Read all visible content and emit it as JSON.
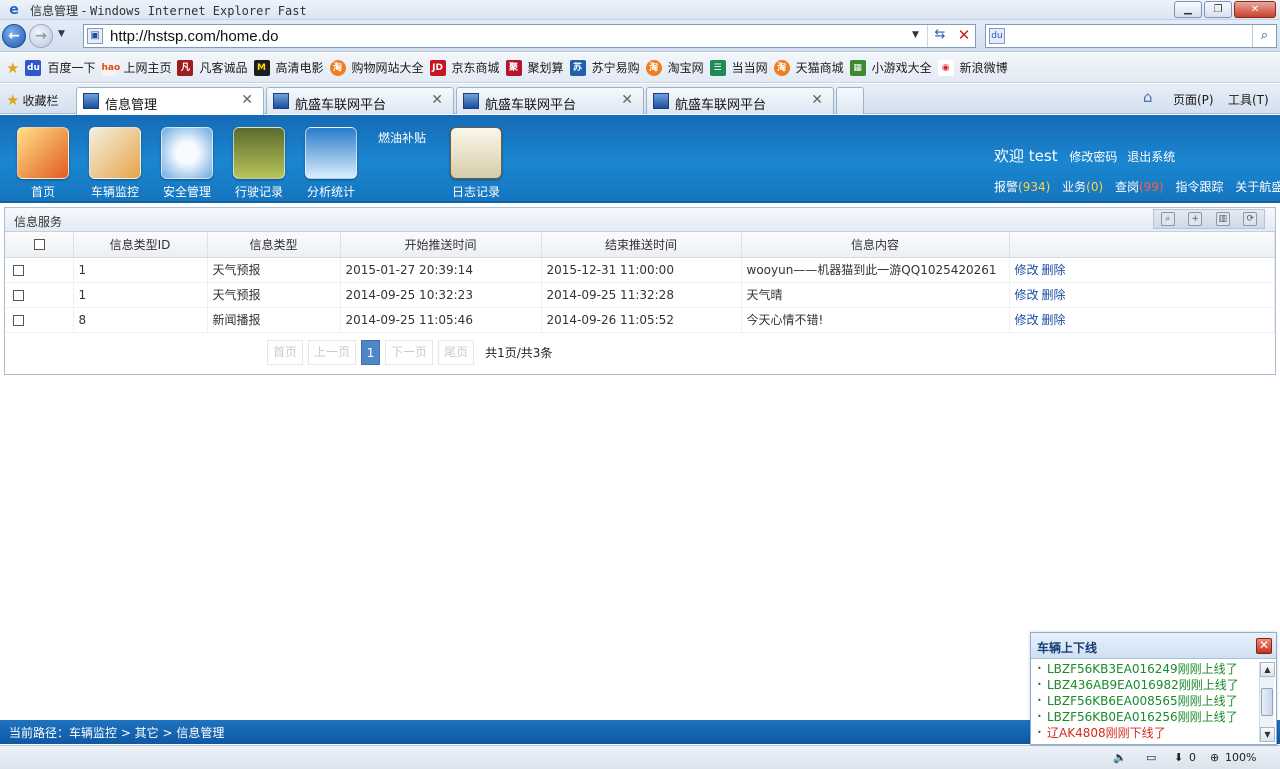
{
  "window": {
    "title_prefix": "信息管理 - ",
    "title_suffix": "Windows Internet Explorer Fast"
  },
  "address": {
    "url": "http://hstsp.com/home.do"
  },
  "favorites_bar": {
    "items": [
      "百度一下",
      "上网主页",
      "凡客诚品",
      "高清电影",
      "购物网站大全",
      "京东商城",
      "聚划算",
      "苏宁易购",
      "淘宝网",
      "当当网",
      "天猫商城",
      "小游戏大全",
      "新浪微博"
    ]
  },
  "tabs": {
    "favorites_label": "收藏栏",
    "items": [
      "信息管理",
      "航盛车联网平台",
      "航盛车联网平台",
      "航盛车联网平台"
    ],
    "page_menu": "页面(P)",
    "tools_menu": "工具(T)"
  },
  "app": {
    "nav": [
      "首页",
      "车辆监控",
      "安全管理",
      "行驶记录",
      "分析统计",
      "日志记录"
    ],
    "fuel_label": "燃油补贴",
    "welcome": "欢迎 test",
    "change_password": "修改密码",
    "logout": "退出系统",
    "status": {
      "alarm_label": "报警",
      "alarm_count": "(934)",
      "business_label": "业务",
      "business_count": "(0)",
      "check_label": "查岗",
      "check_count": "(99)",
      "command_trace": "指令跟踪",
      "about": "关于航盛"
    }
  },
  "panel": {
    "title": "信息服务",
    "columns": [
      "信息类型ID",
      "信息类型",
      "开始推送时间",
      "结束推送时间",
      "信息内容"
    ],
    "rows": [
      {
        "id": "1",
        "type": "天气预报",
        "start": "2015-01-27 20:39:14",
        "end": "2015-12-31 11:00:00",
        "content": "wooyun——机器猫到此一游QQ1025420261",
        "edit": "修改",
        "delete": "删除"
      },
      {
        "id": "1",
        "type": "天气预报",
        "start": "2014-09-25 10:32:23",
        "end": "2014-09-25 11:32:28",
        "content": "天气晴",
        "edit": "修改",
        "delete": "删除"
      },
      {
        "id": "8",
        "type": "新闻播报",
        "start": "2014-09-25 11:05:46",
        "end": "2014-09-26 11:05:52",
        "content": "今天心情不错!",
        "edit": "修改",
        "delete": "删除"
      }
    ],
    "pager": {
      "first": "首页",
      "prev": "上一页",
      "current": "1",
      "next": "下一页",
      "last": "尾页",
      "total": "共1页/共3条"
    }
  },
  "footer": {
    "path": "当前路径：车辆监控 > 其它 > 信息管理"
  },
  "popup": {
    "title": "车辆上下线",
    "lines": [
      {
        "text": "LBZF56KB3EA016249刚刚上线了",
        "status": "online"
      },
      {
        "text": "LBZ436AB9EA016982刚刚上线了",
        "status": "online"
      },
      {
        "text": "LBZF56KB6EA008565刚刚上线了",
        "status": "online"
      },
      {
        "text": "LBZF56KB0EA016256刚刚上线了",
        "status": "online"
      },
      {
        "text": "辽AK4808刚刚下线了",
        "status": "offline"
      }
    ]
  },
  "ie_status": {
    "downloads": "0",
    "zoom": "100%"
  }
}
